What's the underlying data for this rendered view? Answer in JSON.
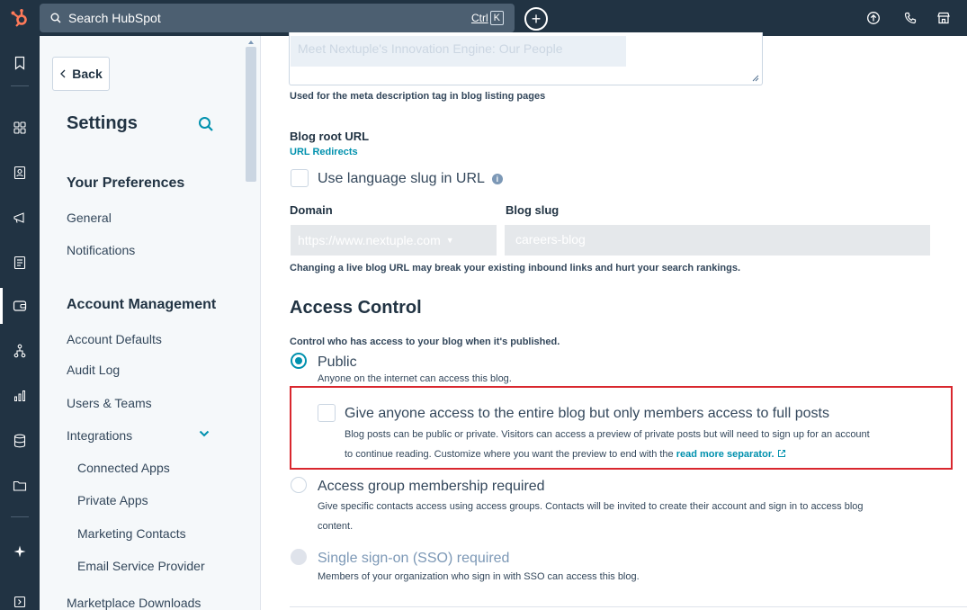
{
  "topbar": {
    "search_placeholder": "Search HubSpot",
    "shortcut_ctrl": "Ctrl",
    "shortcut_key": "K",
    "create_label": "+",
    "icons": [
      "upgrade-icon",
      "phone-icon",
      "marketplace-icon"
    ]
  },
  "rail": {
    "icons": [
      "bookmark-icon",
      "grid-icon",
      "contacts-icon",
      "marketing-icon",
      "content-icon",
      "commerce-icon",
      "automation-icon",
      "reporting-icon",
      "data-icon",
      "library-icon",
      "breeze-icon",
      "expand-icon"
    ]
  },
  "sidebar": {
    "back_label": "Back",
    "title": "Settings",
    "sections": {
      "preferences": "Your Preferences",
      "account": "Account Management"
    },
    "items": {
      "general": "General",
      "notifications": "Notifications",
      "account_defaults": "Account Defaults",
      "audit_log": "Audit Log",
      "users_teams": "Users & Teams",
      "integrations": "Integrations",
      "connected_apps": "Connected Apps",
      "private_apps": "Private Apps",
      "marketing_contacts": "Marketing Contacts",
      "email_service_provider": "Email Service Provider",
      "marketplace_downloads": "Marketplace Downloads"
    }
  },
  "main": {
    "meta_description_value": "Meet Nextuple's Innovation Engine: Our People",
    "meta_help": "Used for the meta description tag in blog listing pages",
    "blog_root_url_label": "Blog root URL",
    "url_redirects_link": "URL Redirects",
    "language_slug_label": "Use language slug in URL",
    "domain_label": "Domain",
    "blog_slug_label": "Blog slug",
    "domain_value": "https://www.nextuple.com",
    "blog_slug_value": "careers-blog",
    "url_warning": "Changing a live blog URL may break your existing inbound links and hurt your search rankings.",
    "access_control_title": "Access Control",
    "access_control_help": "Control who has access to your blog when it's published.",
    "options": {
      "public": {
        "label": "Public",
        "description": "Anyone on the internet can access this blog.",
        "selected": true
      },
      "members_preview": {
        "label": "Give anyone access to the entire blog but only members access to full posts",
        "description_line1": "Blog posts can be public or private. Visitors can access a preview of private posts but will need to sign up for an account",
        "description_line2": "to continue reading. Customize where you want the preview to end with the",
        "link": "read more separator.",
        "checked": false
      },
      "access_group": {
        "label": "Access group membership required",
        "description_line1": "Give specific contacts access using access groups. Contacts will be invited to create their account and sign in to access blog",
        "description_line2": "content.",
        "selected": false
      },
      "sso": {
        "label": "Single sign-on (SSO) required",
        "description": "Members of your organization who sign in with SSO can access this blog.",
        "selected": false,
        "disabled": true
      }
    }
  },
  "colors": {
    "nav_dark": "#213343",
    "accent": "#0091ae",
    "logo": "#ff7a59",
    "highlight_border": "#d9272e"
  }
}
